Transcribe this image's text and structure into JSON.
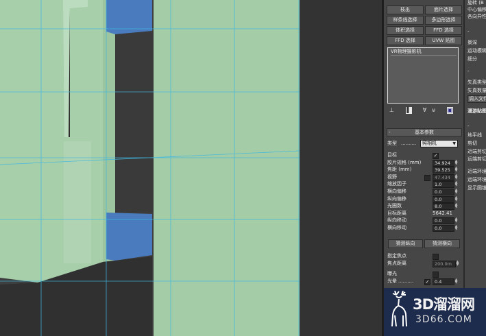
{
  "panel": {
    "buttons_top": [
      {
        "left": "枝出",
        "right": "面片选择"
      },
      {
        "left": "样条线选择",
        "right": "多边形选择"
      },
      {
        "left": "体积选择",
        "right": "FFD 选择"
      },
      {
        "left": "FFD 选择",
        "right": "UVW 贴图"
      }
    ],
    "stack_item": "VR物理摄影机",
    "tool_icons": [
      "pin-icon",
      "active-stack-icon",
      "show-end-icon",
      "make-unique-icon",
      "configure-icon"
    ],
    "basic_params": {
      "title": "基本参数",
      "type_label": "类型",
      "type_value": "照相机",
      "rows": [
        {
          "label": "目标",
          "kind": "check",
          "checked": true
        },
        {
          "label": "胶片规格 (mm)",
          "value": "34.924"
        },
        {
          "label": "焦距 (mm)",
          "value": "39.525"
        },
        {
          "label": "视野",
          "value": "47.434",
          "dim": true,
          "check": true
        },
        {
          "label": "缩放因子",
          "value": "1.0"
        },
        {
          "label": "横向偏移",
          "value": "0.0"
        },
        {
          "label": "纵向偏移",
          "value": "0.0"
        },
        {
          "label": "光圈数",
          "value": "8.0"
        },
        {
          "label": "目标距离",
          "value": "5642.41",
          "plain": true
        },
        {
          "label": "纵向移动",
          "value": "0.0"
        },
        {
          "label": "横向移动",
          "value": "0.0"
        }
      ],
      "guess_vertical": "猜测纵向",
      "guess_horizontal": "猜测横向",
      "specify_focus_label": "指定焦点",
      "focus_distance_label": "焦点距离",
      "focus_distance_value": "200.0m",
      "exposure_label": "曝光",
      "vignetting_label": "光晕",
      "vignetting_value": "0.4"
    }
  },
  "right_panel": {
    "top_lines": [
      "旋转 (B",
      "中心偏移",
      "各向异性"
    ],
    "sec1_lines": [
      "景深",
      "运动模糊",
      "细分"
    ],
    "sec2_lines": [
      "失真类型",
      "失真数量"
    ],
    "sec2_button": "调入文件",
    "sec3_title": "漫游贴图",
    "sec4_lines": [
      "地平线",
      "剪切",
      "近端剪切",
      "远端剪切"
    ],
    "sec5_lines": [
      "近端环境",
      "远端环境",
      "显示圆锥"
    ]
  },
  "watermark": {
    "brand": "3D溜溜网",
    "url": "3D66.COM"
  },
  "colors": {
    "viewport_bg": "#3c3c3c",
    "wall_green": "#a3cca7",
    "grid_cyan": "#3fb8e0",
    "window_blue": "#4a7bbf",
    "panel_bg": "#464646",
    "watermark_bg": "#1d2b4c"
  }
}
